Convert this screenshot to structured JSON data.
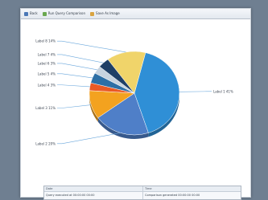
{
  "toolbar": {
    "back_label": "Back",
    "compare_label": "Run Query Comparison",
    "save_label": "Save As Image"
  },
  "chart_data": {
    "type": "pie",
    "title": "",
    "series": [
      {
        "values": [
          41,
          20,
          11,
          3,
          4,
          3,
          4,
          14
        ],
        "labels": [
          "Label 1",
          "Label 2",
          "Label 3",
          "Label 4",
          "Label 5",
          "Label 6",
          "Label 7",
          "Label 8"
        ]
      }
    ],
    "colors": [
      "#2f8fd6",
      "#4f7fc8",
      "#f3a21f",
      "#ea5a24",
      "#2d6fa5",
      "#c7d3df",
      "#1f3f66",
      "#f0d46a"
    ],
    "legend": "callouts"
  },
  "summary": {
    "left_header": "Date",
    "right_header": "Time",
    "left_value": "Query executed at 00:00:00 00:00",
    "right_value": "Comparison generated 00:00:00 00:00"
  }
}
